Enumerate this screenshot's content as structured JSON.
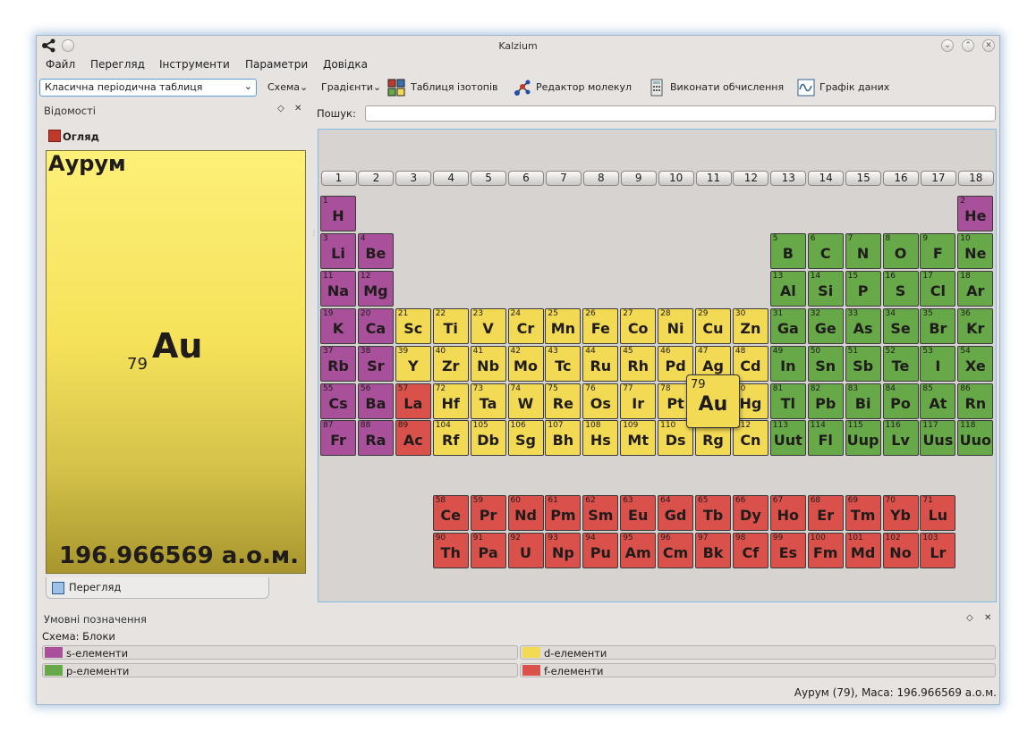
{
  "window": {
    "title": "Kalzium"
  },
  "menubar": [
    "Файл",
    "Перегляд",
    "Інструменти",
    "Параметри",
    "Довідка"
  ],
  "toolbar": {
    "table_select": "Класична періодична таблиця",
    "scheme": "Схема",
    "gradients": "Градієнти",
    "isotopes": "Таблиця ізотопів",
    "molecule_editor": "Редактор молекул",
    "calculate": "Виконати обчислення",
    "data_plot": "Графік даних"
  },
  "info_dock": {
    "title": "Відомості",
    "overview": "Огляд",
    "element_name": "Аурум",
    "element_number": "79",
    "element_symbol": "Au",
    "element_mass": "196.966569 а.о.м.",
    "tab": "Перегляд"
  },
  "search": {
    "label": "Пошук:",
    "value": ""
  },
  "groups": [
    "1",
    "2",
    "3",
    "4",
    "5",
    "6",
    "7",
    "8",
    "9",
    "10",
    "11",
    "12",
    "13",
    "14",
    "15",
    "16",
    "17",
    "18"
  ],
  "selected": {
    "number": "79",
    "symbol": "Au"
  },
  "elements": [
    {
      "n": "1",
      "s": "H",
      "g": 1,
      "p": 1,
      "b": "s"
    },
    {
      "n": "2",
      "s": "He",
      "g": 18,
      "p": 1,
      "b": "s"
    },
    {
      "n": "3",
      "s": "Li",
      "g": 1,
      "p": 2,
      "b": "s"
    },
    {
      "n": "4",
      "s": "Be",
      "g": 2,
      "p": 2,
      "b": "s"
    },
    {
      "n": "5",
      "s": "B",
      "g": 13,
      "p": 2,
      "b": "p"
    },
    {
      "n": "6",
      "s": "C",
      "g": 14,
      "p": 2,
      "b": "p"
    },
    {
      "n": "7",
      "s": "N",
      "g": 15,
      "p": 2,
      "b": "p"
    },
    {
      "n": "8",
      "s": "O",
      "g": 16,
      "p": 2,
      "b": "p"
    },
    {
      "n": "9",
      "s": "F",
      "g": 17,
      "p": 2,
      "b": "p"
    },
    {
      "n": "10",
      "s": "Ne",
      "g": 18,
      "p": 2,
      "b": "p"
    },
    {
      "n": "11",
      "s": "Na",
      "g": 1,
      "p": 3,
      "b": "s"
    },
    {
      "n": "12",
      "s": "Mg",
      "g": 2,
      "p": 3,
      "b": "s"
    },
    {
      "n": "13",
      "s": "Al",
      "g": 13,
      "p": 3,
      "b": "p"
    },
    {
      "n": "14",
      "s": "Si",
      "g": 14,
      "p": 3,
      "b": "p"
    },
    {
      "n": "15",
      "s": "P",
      "g": 15,
      "p": 3,
      "b": "p"
    },
    {
      "n": "16",
      "s": "S",
      "g": 16,
      "p": 3,
      "b": "p"
    },
    {
      "n": "17",
      "s": "Cl",
      "g": 17,
      "p": 3,
      "b": "p"
    },
    {
      "n": "18",
      "s": "Ar",
      "g": 18,
      "p": 3,
      "b": "p"
    },
    {
      "n": "19",
      "s": "K",
      "g": 1,
      "p": 4,
      "b": "s"
    },
    {
      "n": "20",
      "s": "Ca",
      "g": 2,
      "p": 4,
      "b": "s"
    },
    {
      "n": "21",
      "s": "Sc",
      "g": 3,
      "p": 4,
      "b": "d"
    },
    {
      "n": "22",
      "s": "Ti",
      "g": 4,
      "p": 4,
      "b": "d"
    },
    {
      "n": "23",
      "s": "V",
      "g": 5,
      "p": 4,
      "b": "d"
    },
    {
      "n": "24",
      "s": "Cr",
      "g": 6,
      "p": 4,
      "b": "d"
    },
    {
      "n": "25",
      "s": "Mn",
      "g": 7,
      "p": 4,
      "b": "d"
    },
    {
      "n": "26",
      "s": "Fe",
      "g": 8,
      "p": 4,
      "b": "d"
    },
    {
      "n": "27",
      "s": "Co",
      "g": 9,
      "p": 4,
      "b": "d"
    },
    {
      "n": "28",
      "s": "Ni",
      "g": 10,
      "p": 4,
      "b": "d"
    },
    {
      "n": "29",
      "s": "Cu",
      "g": 11,
      "p": 4,
      "b": "d"
    },
    {
      "n": "30",
      "s": "Zn",
      "g": 12,
      "p": 4,
      "b": "d"
    },
    {
      "n": "31",
      "s": "Ga",
      "g": 13,
      "p": 4,
      "b": "p"
    },
    {
      "n": "32",
      "s": "Ge",
      "g": 14,
      "p": 4,
      "b": "p"
    },
    {
      "n": "33",
      "s": "As",
      "g": 15,
      "p": 4,
      "b": "p"
    },
    {
      "n": "34",
      "s": "Se",
      "g": 16,
      "p": 4,
      "b": "p"
    },
    {
      "n": "35",
      "s": "Br",
      "g": 17,
      "p": 4,
      "b": "p"
    },
    {
      "n": "36",
      "s": "Kr",
      "g": 18,
      "p": 4,
      "b": "p"
    },
    {
      "n": "37",
      "s": "Rb",
      "g": 1,
      "p": 5,
      "b": "s"
    },
    {
      "n": "38",
      "s": "Sr",
      "g": 2,
      "p": 5,
      "b": "s"
    },
    {
      "n": "39",
      "s": "Y",
      "g": 3,
      "p": 5,
      "b": "d"
    },
    {
      "n": "40",
      "s": "Zr",
      "g": 4,
      "p": 5,
      "b": "d"
    },
    {
      "n": "41",
      "s": "Nb",
      "g": 5,
      "p": 5,
      "b": "d"
    },
    {
      "n": "42",
      "s": "Mo",
      "g": 6,
      "p": 5,
      "b": "d"
    },
    {
      "n": "43",
      "s": "Tc",
      "g": 7,
      "p": 5,
      "b": "d"
    },
    {
      "n": "44",
      "s": "Ru",
      "g": 8,
      "p": 5,
      "b": "d"
    },
    {
      "n": "45",
      "s": "Rh",
      "g": 9,
      "p": 5,
      "b": "d"
    },
    {
      "n": "46",
      "s": "Pd",
      "g": 10,
      "p": 5,
      "b": "d"
    },
    {
      "n": "47",
      "s": "Ag",
      "g": 11,
      "p": 5,
      "b": "d"
    },
    {
      "n": "48",
      "s": "Cd",
      "g": 12,
      "p": 5,
      "b": "d"
    },
    {
      "n": "49",
      "s": "In",
      "g": 13,
      "p": 5,
      "b": "p"
    },
    {
      "n": "50",
      "s": "Sn",
      "g": 14,
      "p": 5,
      "b": "p"
    },
    {
      "n": "51",
      "s": "Sb",
      "g": 15,
      "p": 5,
      "b": "p"
    },
    {
      "n": "52",
      "s": "Te",
      "g": 16,
      "p": 5,
      "b": "p"
    },
    {
      "n": "53",
      "s": "I",
      "g": 17,
      "p": 5,
      "b": "p"
    },
    {
      "n": "54",
      "s": "Xe",
      "g": 18,
      "p": 5,
      "b": "p"
    },
    {
      "n": "55",
      "s": "Cs",
      "g": 1,
      "p": 6,
      "b": "s"
    },
    {
      "n": "56",
      "s": "Ba",
      "g": 2,
      "p": 6,
      "b": "s"
    },
    {
      "n": "57",
      "s": "La",
      "g": 3,
      "p": 6,
      "b": "f"
    },
    {
      "n": "72",
      "s": "Hf",
      "g": 4,
      "p": 6,
      "b": "d"
    },
    {
      "n": "73",
      "s": "Ta",
      "g": 5,
      "p": 6,
      "b": "d"
    },
    {
      "n": "74",
      "s": "W",
      "g": 6,
      "p": 6,
      "b": "d"
    },
    {
      "n": "75",
      "s": "Re",
      "g": 7,
      "p": 6,
      "b": "d"
    },
    {
      "n": "76",
      "s": "Os",
      "g": 8,
      "p": 6,
      "b": "d"
    },
    {
      "n": "77",
      "s": "Ir",
      "g": 9,
      "p": 6,
      "b": "d"
    },
    {
      "n": "78",
      "s": "Pt",
      "g": 10,
      "p": 6,
      "b": "d"
    },
    {
      "n": "79",
      "s": "Au",
      "g": 11,
      "p": 6,
      "b": "d"
    },
    {
      "n": "80",
      "s": "Hg",
      "g": 12,
      "p": 6,
      "b": "d"
    },
    {
      "n": "81",
      "s": "Tl",
      "g": 13,
      "p": 6,
      "b": "p"
    },
    {
      "n": "82",
      "s": "Pb",
      "g": 14,
      "p": 6,
      "b": "p"
    },
    {
      "n": "83",
      "s": "Bi",
      "g": 15,
      "p": 6,
      "b": "p"
    },
    {
      "n": "84",
      "s": "Po",
      "g": 16,
      "p": 6,
      "b": "p"
    },
    {
      "n": "85",
      "s": "At",
      "g": 17,
      "p": 6,
      "b": "p"
    },
    {
      "n": "86",
      "s": "Rn",
      "g": 18,
      "p": 6,
      "b": "p"
    },
    {
      "n": "87",
      "s": "Fr",
      "g": 1,
      "p": 7,
      "b": "s"
    },
    {
      "n": "88",
      "s": "Ra",
      "g": 2,
      "p": 7,
      "b": "s"
    },
    {
      "n": "89",
      "s": "Ac",
      "g": 3,
      "p": 7,
      "b": "f"
    },
    {
      "n": "104",
      "s": "Rf",
      "g": 4,
      "p": 7,
      "b": "d"
    },
    {
      "n": "105",
      "s": "Db",
      "g": 5,
      "p": 7,
      "b": "d"
    },
    {
      "n": "106",
      "s": "Sg",
      "g": 6,
      "p": 7,
      "b": "d"
    },
    {
      "n": "107",
      "s": "Bh",
      "g": 7,
      "p": 7,
      "b": "d"
    },
    {
      "n": "108",
      "s": "Hs",
      "g": 8,
      "p": 7,
      "b": "d"
    },
    {
      "n": "109",
      "s": "Mt",
      "g": 9,
      "p": 7,
      "b": "d"
    },
    {
      "n": "110",
      "s": "Ds",
      "g": 10,
      "p": 7,
      "b": "d"
    },
    {
      "n": "111",
      "s": "Rg",
      "g": 11,
      "p": 7,
      "b": "d"
    },
    {
      "n": "112",
      "s": "Cn",
      "g": 12,
      "p": 7,
      "b": "d"
    },
    {
      "n": "113",
      "s": "Uut",
      "g": 13,
      "p": 7,
      "b": "p"
    },
    {
      "n": "114",
      "s": "Fl",
      "g": 14,
      "p": 7,
      "b": "p"
    },
    {
      "n": "115",
      "s": "Uup",
      "g": 15,
      "p": 7,
      "b": "p"
    },
    {
      "n": "116",
      "s": "Lv",
      "g": 16,
      "p": 7,
      "b": "p"
    },
    {
      "n": "117",
      "s": "Uus",
      "g": 17,
      "p": 7,
      "b": "p"
    },
    {
      "n": "118",
      "s": "Uuo",
      "g": 18,
      "p": 7,
      "b": "p"
    },
    {
      "n": "58",
      "s": "Ce",
      "g": 4,
      "p": 9,
      "b": "f"
    },
    {
      "n": "59",
      "s": "Pr",
      "g": 5,
      "p": 9,
      "b": "f"
    },
    {
      "n": "60",
      "s": "Nd",
      "g": 6,
      "p": 9,
      "b": "f"
    },
    {
      "n": "61",
      "s": "Pm",
      "g": 7,
      "p": 9,
      "b": "f"
    },
    {
      "n": "62",
      "s": "Sm",
      "g": 8,
      "p": 9,
      "b": "f"
    },
    {
      "n": "63",
      "s": "Eu",
      "g": 9,
      "p": 9,
      "b": "f"
    },
    {
      "n": "64",
      "s": "Gd",
      "g": 10,
      "p": 9,
      "b": "f"
    },
    {
      "n": "65",
      "s": "Tb",
      "g": 11,
      "p": 9,
      "b": "f"
    },
    {
      "n": "66",
      "s": "Dy",
      "g": 12,
      "p": 9,
      "b": "f"
    },
    {
      "n": "67",
      "s": "Ho",
      "g": 13,
      "p": 9,
      "b": "f"
    },
    {
      "n": "68",
      "s": "Er",
      "g": 14,
      "p": 9,
      "b": "f"
    },
    {
      "n": "69",
      "s": "Tm",
      "g": 15,
      "p": 9,
      "b": "f"
    },
    {
      "n": "70",
      "s": "Yb",
      "g": 16,
      "p": 9,
      "b": "f"
    },
    {
      "n": "71",
      "s": "Lu",
      "g": 17,
      "p": 9,
      "b": "f"
    },
    {
      "n": "90",
      "s": "Th",
      "g": 4,
      "p": 10,
      "b": "f"
    },
    {
      "n": "91",
      "s": "Pa",
      "g": 5,
      "p": 10,
      "b": "f"
    },
    {
      "n": "92",
      "s": "U",
      "g": 6,
      "p": 10,
      "b": "f"
    },
    {
      "n": "93",
      "s": "Np",
      "g": 7,
      "p": 10,
      "b": "f"
    },
    {
      "n": "94",
      "s": "Pu",
      "g": 8,
      "p": 10,
      "b": "f"
    },
    {
      "n": "95",
      "s": "Am",
      "g": 9,
      "p": 10,
      "b": "f"
    },
    {
      "n": "96",
      "s": "Cm",
      "g": 10,
      "p": 10,
      "b": "f"
    },
    {
      "n": "97",
      "s": "Bk",
      "g": 11,
      "p": 10,
      "b": "f"
    },
    {
      "n": "98",
      "s": "Cf",
      "g": 12,
      "p": 10,
      "b": "f"
    },
    {
      "n": "99",
      "s": "Es",
      "g": 13,
      "p": 10,
      "b": "f"
    },
    {
      "n": "100",
      "s": "Fm",
      "g": 14,
      "p": 10,
      "b": "f"
    },
    {
      "n": "101",
      "s": "Md",
      "g": 15,
      "p": 10,
      "b": "f"
    },
    {
      "n": "102",
      "s": "No",
      "g": 16,
      "p": 10,
      "b": "f"
    },
    {
      "n": "103",
      "s": "Lr",
      "g": 17,
      "p": 10,
      "b": "f"
    }
  ],
  "legend": {
    "title": "Умовні позначення",
    "scheme": "Схема: Блоки",
    "items": [
      {
        "label": "s-елементи",
        "color": "#a8509a"
      },
      {
        "label": "d-елементи",
        "color": "#f3da55"
      },
      {
        "label": "p-елементи",
        "color": "#67a849"
      },
      {
        "label": "f-елементи",
        "color": "#d9514a"
      }
    ]
  },
  "statusbar": "Аурум (79), Маса: 196.966569 а.о.м."
}
